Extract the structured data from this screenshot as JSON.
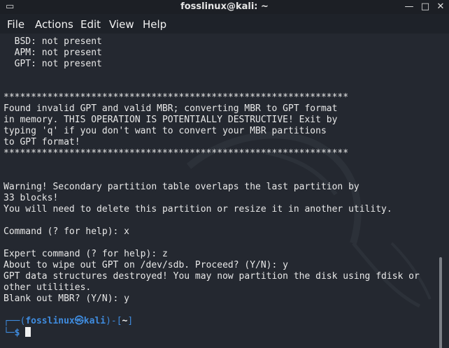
{
  "window": {
    "title": "fosslinux@kali: ~",
    "menu_icon": "terminal-menu-icon",
    "min_icon": "minimize-icon",
    "max_icon": "maximize-icon",
    "close_icon": "close-icon",
    "min_glyph": "—",
    "max_glyph": "□",
    "close_glyph": "✕",
    "left_glyph": "▭"
  },
  "menu": [
    "File",
    "Actions",
    "Edit",
    "View",
    "Help"
  ],
  "terminal": {
    "lines": [
      "  BSD: not present",
      "  APM: not present",
      "  GPT: not present",
      "",
      "",
      "***************************************************************",
      "Found invalid GPT and valid MBR; converting MBR to GPT format",
      "in memory. THIS OPERATION IS POTENTIALLY DESTRUCTIVE! Exit by",
      "typing 'q' if you don't want to convert your MBR partitions",
      "to GPT format!",
      "***************************************************************",
      "",
      "",
      "Warning! Secondary partition table overlaps the last partition by",
      "33 blocks!",
      "You will need to delete this partition or resize it in another utility.",
      "",
      "Command (? for help): x",
      "",
      "Expert command (? for help): z",
      "About to wipe out GPT on /dev/sdb. Proceed? (Y/N): y",
      "GPT data structures destroyed! You may now partition the disk using fdisk or",
      "other utilities.",
      "Blank out MBR? (Y/N): y",
      ""
    ],
    "prompt": {
      "line1_prefix": "┌──(",
      "user": "fosslinux㉿kali",
      "line1_mid": ")-[",
      "path": "~",
      "line1_suffix": "]",
      "line2_prefix": "└─",
      "dollar": "$ "
    }
  },
  "colors": {
    "background": "#242830",
    "prompt": "#3f8cdf",
    "text": "#e8e8e8"
  }
}
